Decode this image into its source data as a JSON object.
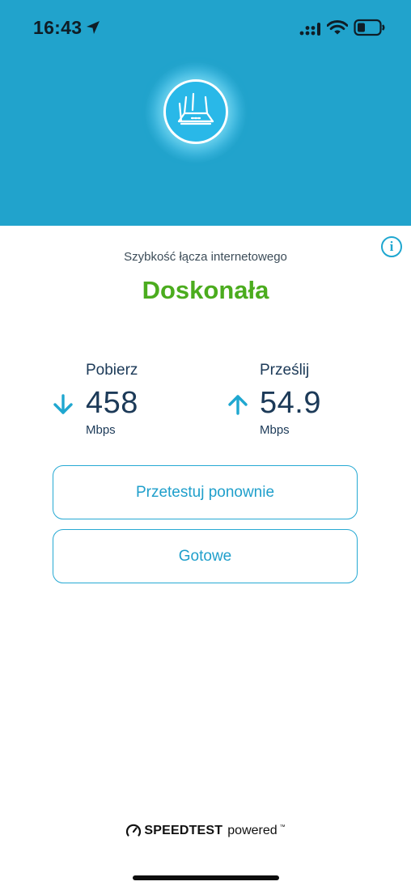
{
  "status_bar": {
    "time": "16:43",
    "icons": [
      "location-arrow-icon",
      "cellular-signal-icon",
      "wifi-icon",
      "battery-icon"
    ]
  },
  "header": {
    "background_color": "#21a3cc",
    "icon": "router-icon"
  },
  "result": {
    "subtitle": "Szybkość łącza internetowego",
    "rating": "Doskonała",
    "rating_color": "#4bac1e"
  },
  "download": {
    "label": "Pobierz",
    "value": "458",
    "unit": "Mbps",
    "icon": "arrow-down-icon"
  },
  "upload": {
    "label": "Prześlij",
    "value": "54.9",
    "unit": "Mbps",
    "icon": "arrow-up-icon"
  },
  "buttons": {
    "retest_label": "Przetestuj ponownie",
    "done_label": "Gotowe"
  },
  "footer": {
    "brand": "SPEEDTEST",
    "powered": "powered",
    "trademark": "™"
  },
  "accent_color": "#1f9fcb"
}
